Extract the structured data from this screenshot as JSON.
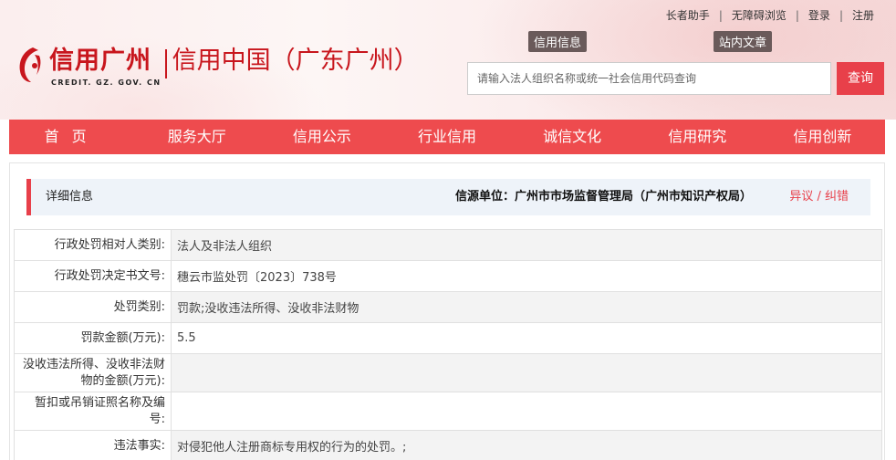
{
  "top_links": [
    "长者助手",
    "无障碍浏览",
    "登录",
    "注册"
  ],
  "logo": {
    "cn": "信用广州",
    "en": "CREDIT. GZ. GOV. CN",
    "title": "信用中国（广东广州）"
  },
  "tags": [
    "信用信息",
    "站内文章"
  ],
  "search": {
    "placeholder": "请输入法人组织名称或统一社会信用代码查询",
    "button": "查询"
  },
  "nav": [
    "首页",
    "服务大厅",
    "信用公示",
    "行业信用",
    "诚信文化",
    "信用研究",
    "信用创新"
  ],
  "detail": {
    "title": "详细信息",
    "source": "信源单位：广州市市场监督管理局（广州市知识产权局）",
    "objection": "异议 / 纠错"
  },
  "rows": [
    {
      "label": "行政处罚相对人类别:",
      "value": "法人及非法人组织"
    },
    {
      "label": "行政处罚决定书文号:",
      "value": "穗云市监处罚〔2023〕738号"
    },
    {
      "label": "处罚类别:",
      "value": "罚款;没收违法所得、没收非法财物"
    },
    {
      "label": "罚款金额(万元):",
      "value": "5.5"
    },
    {
      "label": "没收违法所得、没收非法财物的金额(万元):",
      "value": ""
    },
    {
      "label": "暂扣或吊销证照名称及编号:",
      "value": ""
    },
    {
      "label": "违法事实:",
      "value": "对侵犯他人注册商标专用权的行为的处罚。;"
    }
  ],
  "colors": {
    "accent": "#ee4b4e",
    "brand": "#c8161d"
  }
}
